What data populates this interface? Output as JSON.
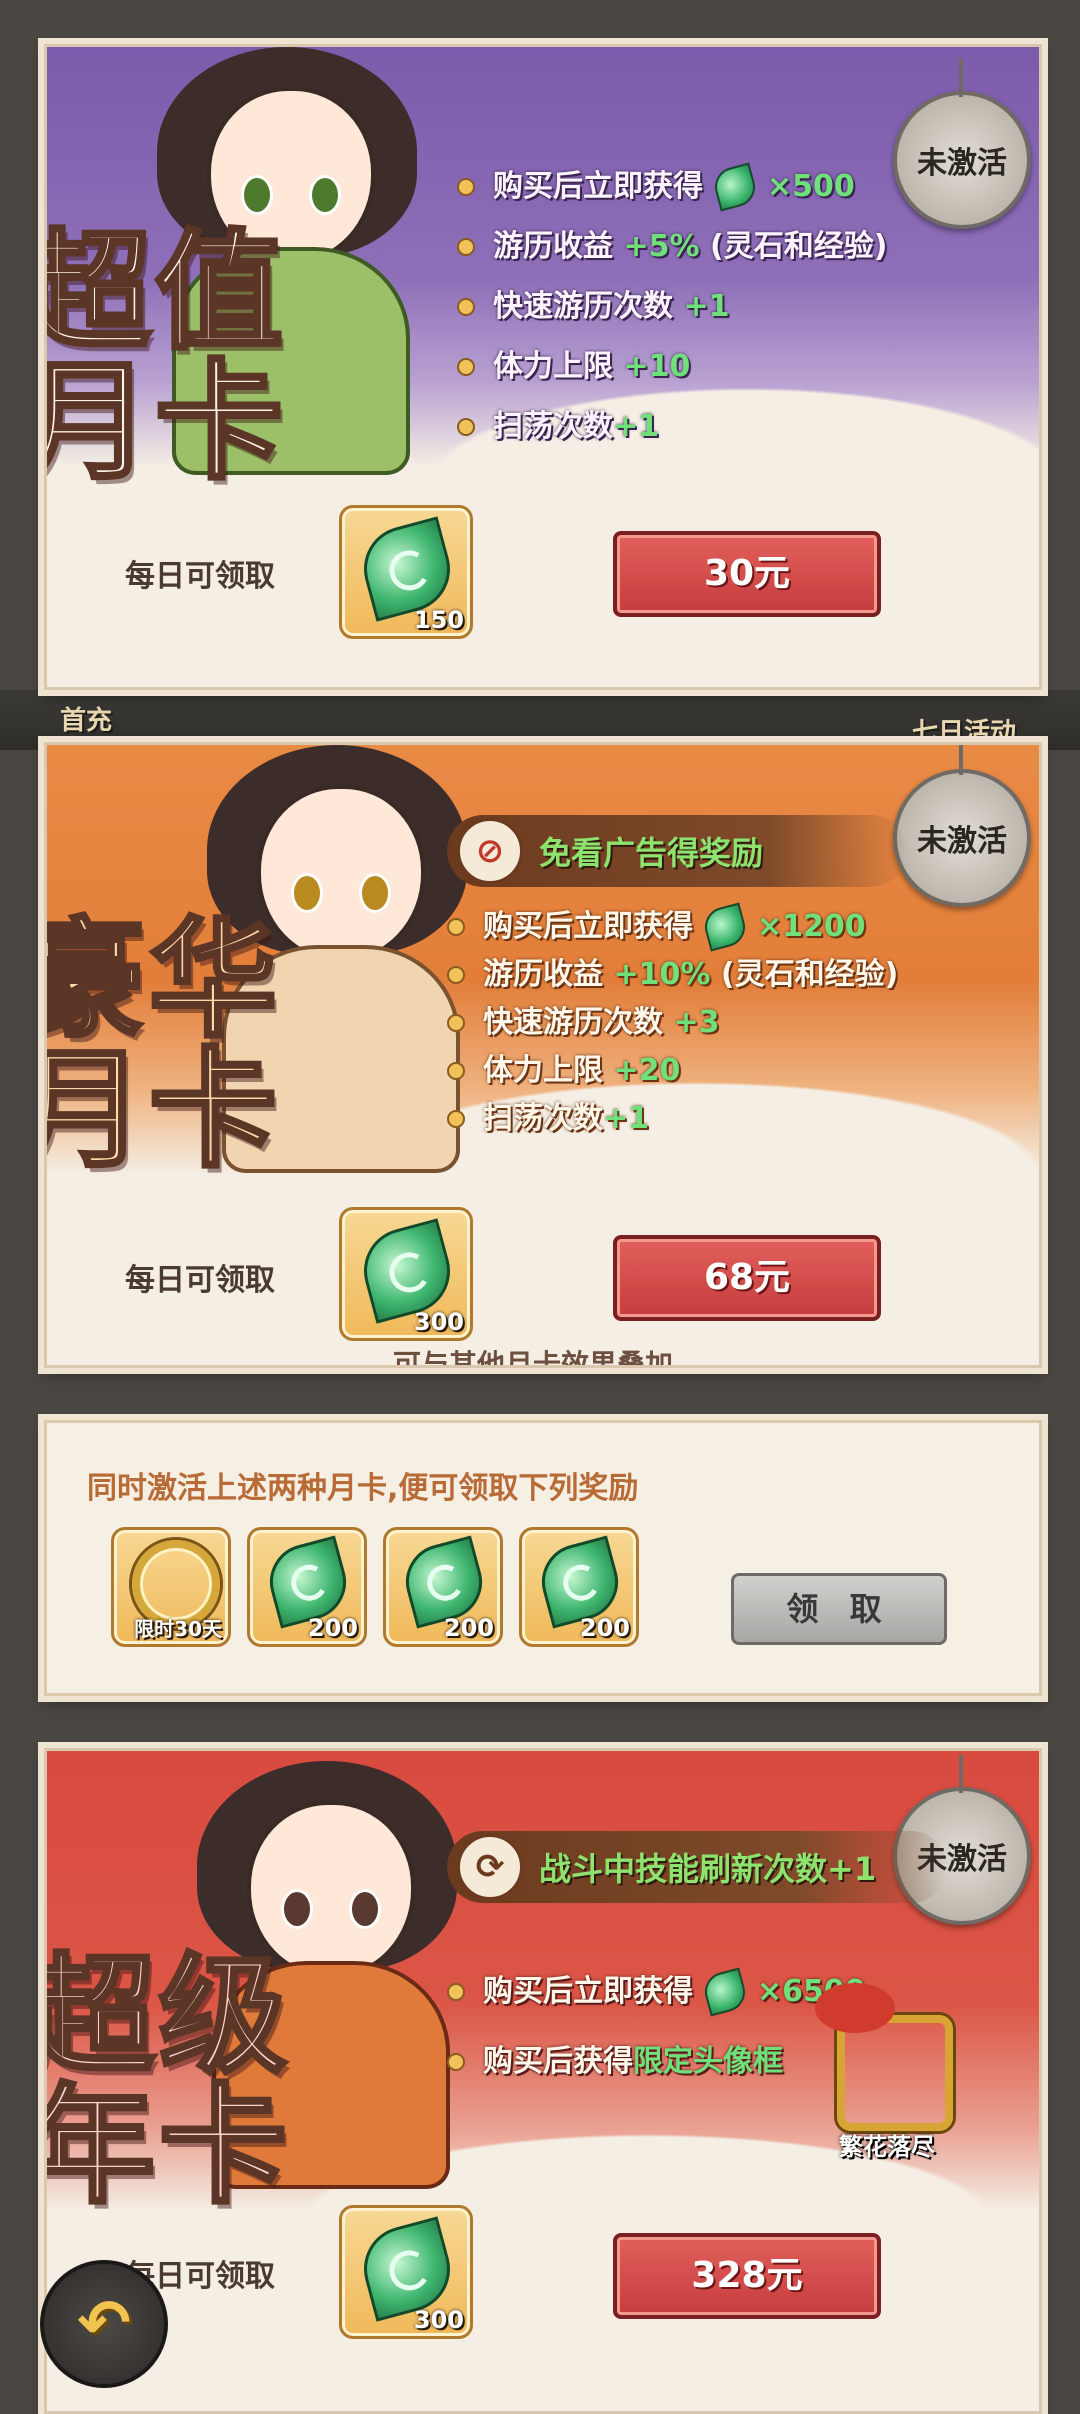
{
  "cards": [
    {
      "title": "超值月卡",
      "status": "未激活",
      "benefits": [
        {
          "text": "购买后立即获得",
          "bonus": "×500"
        },
        {
          "text": "游历收益",
          "bonus": "+5%",
          "extra": "(灵石和经验)"
        },
        {
          "text": "快速游历次数",
          "bonus": "+1"
        },
        {
          "text": "体力上限",
          "bonus": "+10"
        },
        {
          "text": "扫荡次数",
          "bonus": "+1"
        }
      ],
      "daily_label": "每日可领取",
      "daily_qty": "150",
      "price": "30元"
    },
    {
      "title": "豪华月卡",
      "status": "未激活",
      "ad_banner": "免看广告得奖励",
      "benefits": [
        {
          "text": "购买后立即获得",
          "bonus": "×1200"
        },
        {
          "text": "游历收益",
          "bonus": "+10%",
          "extra": "(灵石和经验)"
        },
        {
          "text": "快速游历次数",
          "bonus": "+3"
        },
        {
          "text": "体力上限",
          "bonus": "+20"
        },
        {
          "text": "扫荡次数",
          "bonus": "+1"
        }
      ],
      "daily_label": "每日可领取",
      "daily_qty": "300",
      "price": "68元",
      "note": "可与其他月卡效果叠加"
    },
    {
      "title": "超级年卡",
      "status": "未激活",
      "skill_banner": "战斗中技能刷新次数+1",
      "benefits": [
        {
          "text": "购买后立即获得",
          "bonus": "×6500"
        },
        {
          "text": "购买后获得",
          "bonus": "限定头像框"
        }
      ],
      "frame_name": "繁花落尽",
      "daily_label": "每日可领取",
      "daily_qty": "300",
      "price": "328元"
    }
  ],
  "combo": {
    "title": "同时激活上述两种月卡,便可领取下列奖励",
    "items": [
      {
        "label": "限时30天"
      },
      {
        "qty": "200"
      },
      {
        "qty": "200"
      },
      {
        "qty": "200"
      }
    ],
    "claim": "领 取"
  },
  "background": {
    "left_tab": "首充",
    "right_tab": "七日活动"
  },
  "icons": {
    "currency": "jade-leaf-icon",
    "back": "back-arrow-icon",
    "ad": "no-ad-icon",
    "refresh": "refresh-icon"
  },
  "colors": {
    "card1_accent": "#8e6fb8",
    "card2_accent": "#e27e3a",
    "card4_accent": "#db5646",
    "price_button": "#c53c3c",
    "bonus_green": "#6fe07a"
  }
}
